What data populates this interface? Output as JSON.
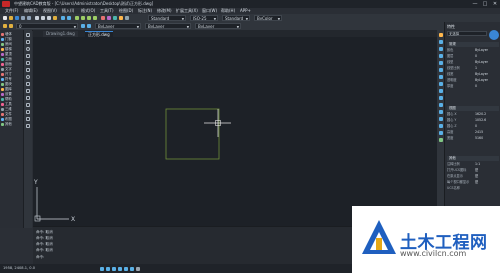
{
  "window": {
    "title": "中望建筑CAD教育版 - [C:\\Users\\Administrator\\Desktop\\测试\\正方形.dwg]",
    "buttons": [
      "—",
      "□",
      "✕"
    ]
  },
  "menu": [
    "文件(F)",
    "编辑(E)",
    "视图(V)",
    "插入(I)",
    "格式(O)",
    "工具(T)",
    "绘图(D)",
    "标注(N)",
    "修改(M)",
    "扩展工具(X)",
    "窗口(W)",
    "帮助(H)",
    "APP+"
  ],
  "toolbar": {
    "layer_combo": "0",
    "linetype_combo": "ByLayer",
    "color_combo": "ByLayer",
    "lineweight_combo": "ByLayer",
    "style_combo": "Standard",
    "dim_combo": "ISO-25",
    "text_combo": "Standard",
    "plot_combo": "ByColor"
  },
  "left_panel": {
    "items": [
      "墙体",
      "门窗",
      "房间",
      "楼梯",
      "屋顶",
      "立面",
      "剖面",
      "文字",
      "尺寸",
      "符号",
      "图块",
      "图库",
      "设置",
      "帮助",
      "工具",
      "三维",
      "文件",
      "布图",
      "其他"
    ]
  },
  "tabs": [
    {
      "label": "Drawing1.dwg",
      "active": false
    },
    {
      "label": "正方形.dwg",
      "active": true
    }
  ],
  "ucs": {
    "x_label": "X",
    "y_label": "Y"
  },
  "command": {
    "lines": [
      "命令: 取消",
      "命令: 取消",
      "命令: 取消",
      "命令: 取消",
      "命令:"
    ]
  },
  "status": {
    "coords": "1958, 2408.1, 0.0"
  },
  "properties": {
    "title": "特性",
    "selection": "无选择",
    "general_header": "常规",
    "general": [
      {
        "k": "颜色",
        "v": "ByLayer"
      },
      {
        "k": "图层",
        "v": "0"
      },
      {
        "k": "线型",
        "v": "ByLayer"
      },
      {
        "k": "线型比例",
        "v": "1"
      },
      {
        "k": "线宽",
        "v": "ByLayer"
      },
      {
        "k": "透明度",
        "v": "ByLayer"
      },
      {
        "k": "厚度",
        "v": "0"
      }
    ],
    "view_header": "视图",
    "view": [
      {
        "k": "圆心 X",
        "v": "1620.2"
      },
      {
        "k": "圆心 Y",
        "v": "1052.6"
      },
      {
        "k": "圆心 Z",
        "v": "0"
      },
      {
        "k": "高度",
        "v": "2415"
      },
      {
        "k": "宽度",
        "v": "5160"
      }
    ],
    "misc_header": "其他",
    "misc": [
      {
        "k": "注释比例",
        "v": "1:1"
      },
      {
        "k": "打开UCS图标",
        "v": "是"
      },
      {
        "k": "在原点显示",
        "v": "是"
      },
      {
        "k": "每个视口都显示",
        "v": "是"
      },
      {
        "k": "UCS名称",
        "v": ""
      }
    ]
  },
  "watermark": {
    "brand": "土木工程网",
    "url": "www.civilcn.com"
  },
  "colors": {
    "canvas": "#1d2127",
    "rectangle": "#6f8f3a",
    "crosshair": "#e6e6e6",
    "accent": "#3a86d4",
    "watermark_blue": "#1f5fbf"
  }
}
